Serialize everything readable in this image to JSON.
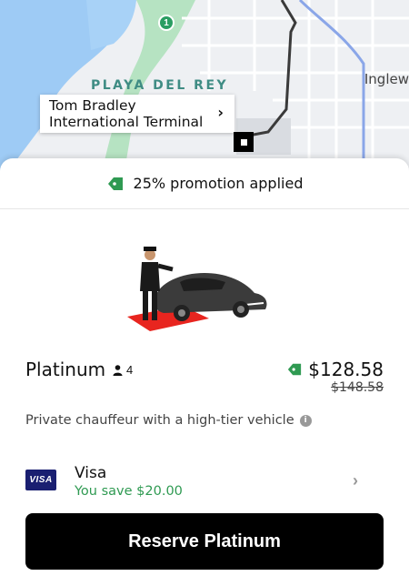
{
  "map": {
    "area_label": "PLAYA DEL REY",
    "city_label": "Inglew",
    "route_badge": "1",
    "callout": {
      "line1": "Tom Bradley",
      "line2": "International Terminal",
      "chevron": "›"
    }
  },
  "promo": {
    "text": "25% promotion applied",
    "icon": "tag-icon"
  },
  "product": {
    "name": "Platinum",
    "seats": "4",
    "price": "$128.58",
    "original_price": "$148.58",
    "description": "Private chauffeur with a high-tier vehicle"
  },
  "payment": {
    "logo_text": "VISA",
    "method": "Visa",
    "savings": "You save $20.00",
    "chevron": "›"
  },
  "cta": {
    "label": "Reserve Platinum"
  },
  "colors": {
    "promo_green": "#2f9a52",
    "button_bg": "#000000",
    "visa_blue": "#1a1f71"
  }
}
